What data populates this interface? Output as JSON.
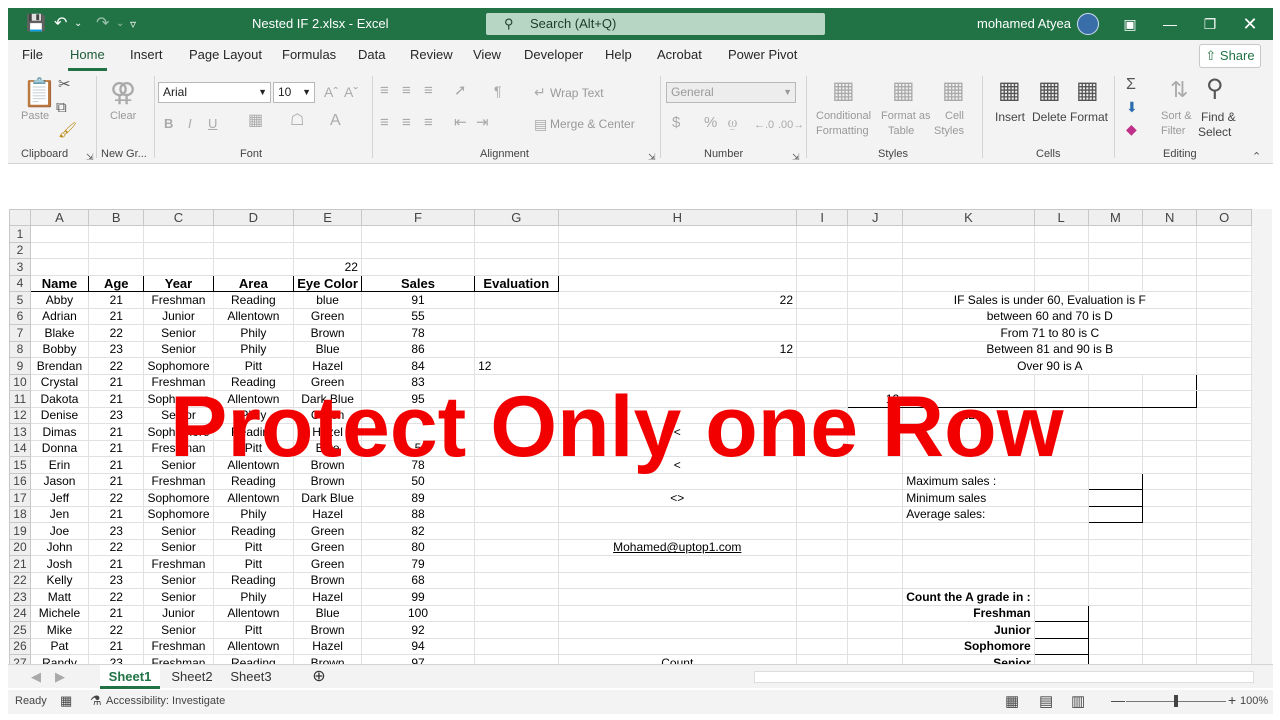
{
  "titlebar": {
    "save_icon": "save-icon",
    "undo_icon": "undo-icon",
    "redo_icon": "redo-icon",
    "qat_icon": "customize-qat-icon",
    "file_title": "Nested IF 2.xlsx  -  Excel",
    "search_placeholder": "Search (Alt+Q)",
    "user": "mohamed Atyea"
  },
  "ribbon_tabs": [
    "File",
    "Home",
    "Insert",
    "Page Layout",
    "Formulas",
    "Data",
    "Review",
    "View",
    "Developer",
    "Help",
    "Acrobat",
    "Power Pivot"
  ],
  "share_label": "Share",
  "ribbon": {
    "clipboard": {
      "paste": "Paste",
      "group": "Clipboard"
    },
    "newgroup": {
      "clear": "Clear",
      "group": "New Gr..."
    },
    "font": {
      "name": "Arial",
      "size": "10",
      "group": "Font",
      "bold": "B",
      "italic": "I",
      "underline": "U"
    },
    "alignment": {
      "wrap": "Wrap Text",
      "merge": "Merge & Center",
      "group": "Alignment"
    },
    "number": {
      "format": "General",
      "group": "Number"
    },
    "styles": {
      "cond1": "Conditional",
      "cond2": "Formatting",
      "fmt1": "Format as",
      "fmt2": "Table",
      "cell1": "Cell",
      "cell2": "Styles",
      "group": "Styles"
    },
    "cells": {
      "insert": "Insert",
      "delete": "Delete",
      "format": "Format",
      "group": "Cells"
    },
    "editing": {
      "sort1": "Sort &",
      "sort2": "Filter",
      "find1": "Find &",
      "find2": "Select",
      "group": "Editing"
    }
  },
  "columns": [
    "A",
    "B",
    "C",
    "D",
    "E",
    "F",
    "G",
    "H",
    "I",
    "J",
    "K",
    "L",
    "M",
    "N",
    "O"
  ],
  "rows": [
    {
      "n": "1"
    },
    {
      "n": "2"
    },
    {
      "n": "3",
      "E": "22"
    },
    {
      "n": "4",
      "A": "Name",
      "B": "Age",
      "C": "Year",
      "D": "Area",
      "E": "Eye Color",
      "F": "Sales",
      "G": "Evaluation"
    },
    {
      "n": "5",
      "A": "Abby",
      "B": "21",
      "C": "Freshman",
      "D": "Reading",
      "E": "blue",
      "F": "91",
      "H": "22",
      "K": "IF Sales is under 60, Evaluation is F"
    },
    {
      "n": "6",
      "A": "Adrian",
      "B": "21",
      "C": "Junior",
      "D": "Allentown",
      "E": "Green",
      "F": "55",
      "K": "between 60 and 70 is D"
    },
    {
      "n": "7",
      "A": "Blake",
      "B": "22",
      "C": "Senior",
      "D": "Phily",
      "E": "Brown",
      "F": "78",
      "K": "From 71 to 80 is C"
    },
    {
      "n": "8",
      "A": "Bobby",
      "B": "23",
      "C": "Senior",
      "D": "Phily",
      "E": "Blue",
      "F": "86",
      "H": "12",
      "K": "Between 81 and 90 is B"
    },
    {
      "n": "9",
      "A": "Brendan",
      "B": "22",
      "C": "Sophomore",
      "D": "Pitt",
      "E": "Hazel",
      "F": "84",
      "G": "12",
      "K": "Over 90 is A"
    },
    {
      "n": "10",
      "A": "Crystal",
      "B": "21",
      "C": "Freshman",
      "D": "Reading",
      "E": "Green",
      "F": "83"
    },
    {
      "n": "11",
      "A": "Dakota",
      "B": "21",
      "C": "Sophomore",
      "D": "Allentown",
      "E": "Dark Blue",
      "F": "95",
      "J": "12"
    },
    {
      "n": "12",
      "A": "Denise",
      "B": "23",
      "C": "Senior",
      "D": "Phily",
      "E": "Green",
      "F": "",
      "K": "12"
    },
    {
      "n": "13",
      "A": "Dimas",
      "B": "21",
      "C": "Sophomore",
      "D": "Reading",
      "E": "Hazel",
      "F": "",
      "H": "<"
    },
    {
      "n": "14",
      "A": "Donna",
      "B": "21",
      "C": "Freshman",
      "D": "Pitt",
      "E": "Blue",
      "F": "5"
    },
    {
      "n": "15",
      "A": "Erin",
      "B": "21",
      "C": "Senior",
      "D": "Allentown",
      "E": "Brown",
      "F": "78",
      "H": "<"
    },
    {
      "n": "16",
      "A": "Jason",
      "B": "21",
      "C": "Freshman",
      "D": "Reading",
      "E": "Brown",
      "F": "50",
      "K": "Maximum sales :"
    },
    {
      "n": "17",
      "A": "Jeff",
      "B": "22",
      "C": "Sophomore",
      "D": "Allentown",
      "E": "Dark Blue",
      "F": "89",
      "H": "<>",
      "K": "Minimum sales"
    },
    {
      "n": "18",
      "A": "Jen",
      "B": "21",
      "C": "Sophomore",
      "D": "Phily",
      "E": "Hazel",
      "F": "88",
      "K": "Average sales:"
    },
    {
      "n": "19",
      "A": "Joe",
      "B": "23",
      "C": "Senior",
      "D": "Reading",
      "E": "Green",
      "F": "82"
    },
    {
      "n": "20",
      "A": "John",
      "B": "22",
      "C": "Senior",
      "D": "Pitt",
      "E": "Green",
      "F": "80",
      "H": "Mohamed@uptop1.com"
    },
    {
      "n": "21",
      "A": "Josh",
      "B": "21",
      "C": "Freshman",
      "D": "Pitt",
      "E": "Green",
      "F": "79"
    },
    {
      "n": "22",
      "A": "Kelly",
      "B": "23",
      "C": "Senior",
      "D": "Reading",
      "E": "Brown",
      "F": "68"
    },
    {
      "n": "23",
      "A": "Matt",
      "B": "22",
      "C": "Senior",
      "D": "Phily",
      "E": "Hazel",
      "F": "99",
      "K": "Count the A grade in :"
    },
    {
      "n": "24",
      "A": "Michele",
      "B": "21",
      "C": "Junior",
      "D": "Allentown",
      "E": "Blue",
      "F": "100",
      "K": "Freshman"
    },
    {
      "n": "25",
      "A": "Mike",
      "B": "22",
      "C": "Senior",
      "D": "Pitt",
      "E": "Brown",
      "F": "92",
      "K": "Junior"
    },
    {
      "n": "26",
      "A": "Pat",
      "B": "21",
      "C": "Freshman",
      "D": "Allentown",
      "E": "Hazel",
      "F": "94",
      "K": "Sophomore"
    },
    {
      "n": "27",
      "A": "Randy",
      "B": "23",
      "C": "Freshman",
      "D": "Reading",
      "E": "Brown",
      "F": "97",
      "H": "Count",
      "K": "Senior"
    }
  ],
  "overlay_text": "Protect Only one Row",
  "sheets": [
    "Sheet1",
    "Sheet2",
    "Sheet3"
  ],
  "status": {
    "ready": "Ready",
    "accessibility": "Accessibility: Investigate",
    "zoom": "100%"
  }
}
